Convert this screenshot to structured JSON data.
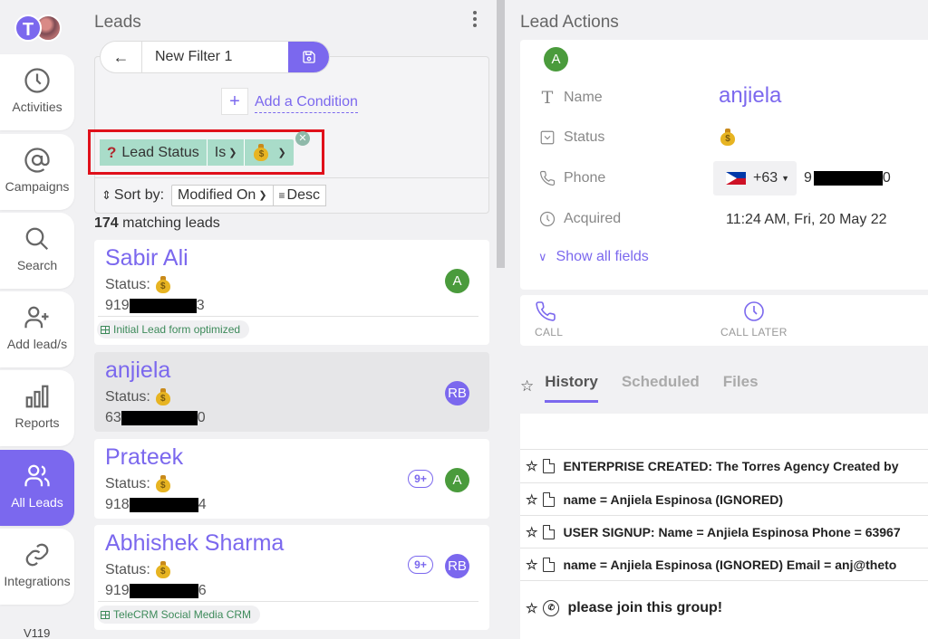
{
  "sidebar": {
    "user_initial": "T",
    "items": [
      {
        "label": "Activities",
        "icon": "clock-icon"
      },
      {
        "label": "Campaigns",
        "icon": "at-sign-icon"
      },
      {
        "label": "Search",
        "icon": "search-icon"
      },
      {
        "label": "Add lead/s",
        "icon": "add-user-icon"
      },
      {
        "label": "Reports",
        "icon": "bar-chart-icon"
      },
      {
        "label": "All Leads",
        "icon": "users-icon",
        "active": true
      },
      {
        "label": "Integrations",
        "icon": "link-icon"
      }
    ],
    "version": "V119"
  },
  "leads": {
    "title": "Leads",
    "filter": {
      "back_icon": "←",
      "name": "New Filter 1",
      "add_condition_label": "Add a Condition",
      "condition": {
        "field": "Lead Status",
        "operator": "Is",
        "value_icon": "money-bag-icon"
      }
    },
    "sort": {
      "label": "Sort by:",
      "field": "Modified On",
      "direction": "Desc"
    },
    "match_count": "174",
    "match_suffix": "matching leads",
    "cards": [
      {
        "name": "Sabir Ali",
        "status_label": "Status:",
        "phone_prefix": "919",
        "phone_suffix": "3",
        "avatar": "A",
        "badge": "",
        "tag": "Initial Lead form optimized"
      },
      {
        "name": "anjiela",
        "status_label": "Status:",
        "phone_prefix": "63",
        "phone_suffix": "0",
        "avatar": "RB",
        "badge": "",
        "tag": ""
      },
      {
        "name": "Prateek",
        "status_label": "Status:",
        "phone_prefix": "918",
        "phone_suffix": "4",
        "avatar": "A",
        "badge": "9+",
        "tag": ""
      },
      {
        "name": "Abhishek Sharma",
        "status_label": "Status:",
        "phone_prefix": "919",
        "phone_suffix": "6",
        "avatar": "RB",
        "badge": "9+",
        "tag": "TeleCRM Social Media CRM"
      }
    ]
  },
  "lead_actions": {
    "title": "Lead Actions",
    "avatar": "A",
    "fields": {
      "name_label": "Name",
      "name_value": "anjiela",
      "status_label": "Status",
      "phone_label": "Phone",
      "phone_code": "+63",
      "phone_prefix": "9",
      "phone_suffix": "0",
      "acquired_label": "Acquired",
      "acquired_value": "11:24 AM, Fri, 20 May 22"
    },
    "show_all_label": "Show all fields",
    "call_label": "CALL",
    "call_later_label": "CALL LATER",
    "tabs": [
      "History",
      "Scheduled",
      "Files"
    ],
    "history": [
      {
        "text": "ENTERPRISE CREATED: The Torres Agency Created by",
        "icon": "document-icon"
      },
      {
        "text": "name = Anjiela Espinosa (IGNORED)",
        "icon": "document-icon"
      },
      {
        "text": "USER SIGNUP: Name = Anjiela Espinosa Phone = 63967",
        "icon": "document-icon"
      },
      {
        "text": "name = Anjiela Espinosa (IGNORED) Email = anj@theto",
        "icon": "document-icon"
      },
      {
        "text": "please join this group!",
        "icon": "whatsapp-icon"
      }
    ]
  }
}
